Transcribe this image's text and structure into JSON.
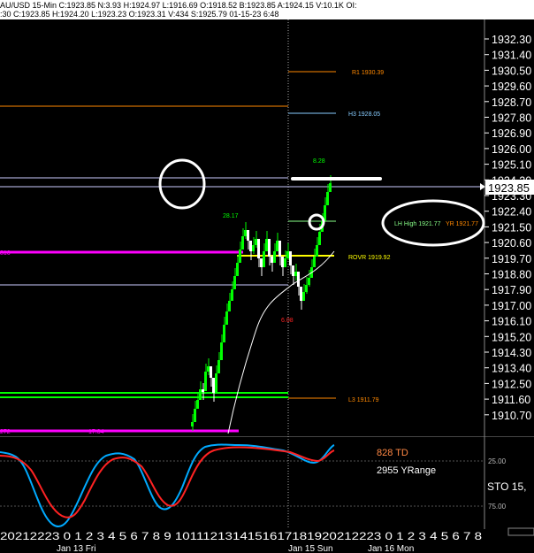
{
  "header": {
    "line1": "AU/USD 15-Min C:1923.85 N:3.93 H:1924.97 L:1916.69 O:1918.52 B:1923.85 A:1924.15 V:10.1K OI:",
    "line2": ":30 C:1923.85 H:1924.20 L:1923.23 O:1923.31 V:434 S:1925.79 01-15-23 6:48"
  },
  "price_axis": {
    "ticks": [
      "1932.30",
      "1931.40",
      "1930.50",
      "1929.60",
      "1928.70",
      "1927.80",
      "1926.90",
      "1926.00",
      "1925.10",
      "1924.20",
      "1923.30",
      "1922.40",
      "1921.50",
      "1920.60",
      "1919.70",
      "1918.80",
      "1917.90",
      "1917.00",
      "1916.10",
      "1915.20",
      "1914.30",
      "1913.40",
      "1912.50",
      "1911.60",
      "1910.70"
    ],
    "current_price": "1923.85"
  },
  "levels": {
    "r1": "R1 1930.39",
    "h3": "H3 1928.05",
    "lh": "LH High 1921.77",
    "yr": "YR 1921.77",
    "rovr": "ROVR 1919.92",
    "l3": "L3 1911.79",
    "left_816": "816",
    "left_272": "272",
    "left_1734": "17:34"
  },
  "annotations": {
    "a828": "8.28",
    "a2817": "28.17",
    "a608": "6.08"
  },
  "oscillator": {
    "td": "828 TD",
    "yrange": "2955 YRange",
    "sto": "STO 15,",
    "level25": "25.00",
    "level75": "75.00"
  },
  "time_axis": {
    "hours": "20212223 0  1  2  3  4  5  6  7  8  9 1011121314151617181920212223 0  1  2  3  4  5  6  7  8",
    "day1": "Jan 13 Fri",
    "day2": "Jan 15 Sun",
    "day3": "Jan 16 Mon"
  },
  "colors": {
    "background": "#000000",
    "up_candle": "#00ff00",
    "down_candle": "#ffffff",
    "magenta": "#ff00ff",
    "green_level": "#00ff00",
    "yellow_level": "#ffff00",
    "orange_level": "#ff8800",
    "cyan_level": "#88ccff",
    "stoch_k": "#00aaff",
    "stoch_d": "#ff2222"
  },
  "chart_data": {
    "type": "candlestick",
    "title": "AU/USD 15-Min",
    "ylim": [
      1910.0,
      1933.0
    ],
    "levels": [
      {
        "label": "R1",
        "value": 1930.39
      },
      {
        "label": "H3",
        "value": 1928.05
      },
      {
        "label": "LH High",
        "value": 1921.77
      },
      {
        "label": "YR",
        "value": 1921.77
      },
      {
        "label": "ROVR",
        "value": 1919.92
      },
      {
        "label": "L3",
        "value": 1911.79
      }
    ],
    "last_close": 1923.85
  }
}
